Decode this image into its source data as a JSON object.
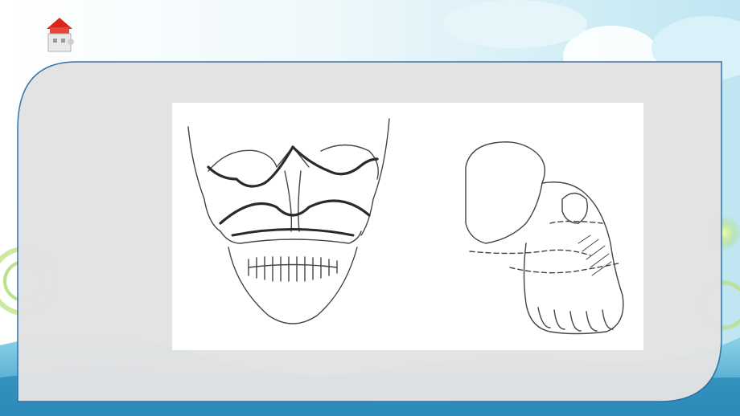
{
  "slide": {
    "logo_icon": "puzzle-house-icon",
    "figure": {
      "description_icon": "skull-fracture-lines-illustration",
      "panels": [
        "skull-frontal-view",
        "skull-lateral-view"
      ]
    }
  },
  "colors": {
    "panel_fill": "#e3e3e4",
    "panel_border": "#2f6fa8",
    "sky": "#d8f0f8",
    "sea": "#4fb8d8",
    "accent_green": "#9fd35a",
    "logo_red": "#d8261c"
  }
}
